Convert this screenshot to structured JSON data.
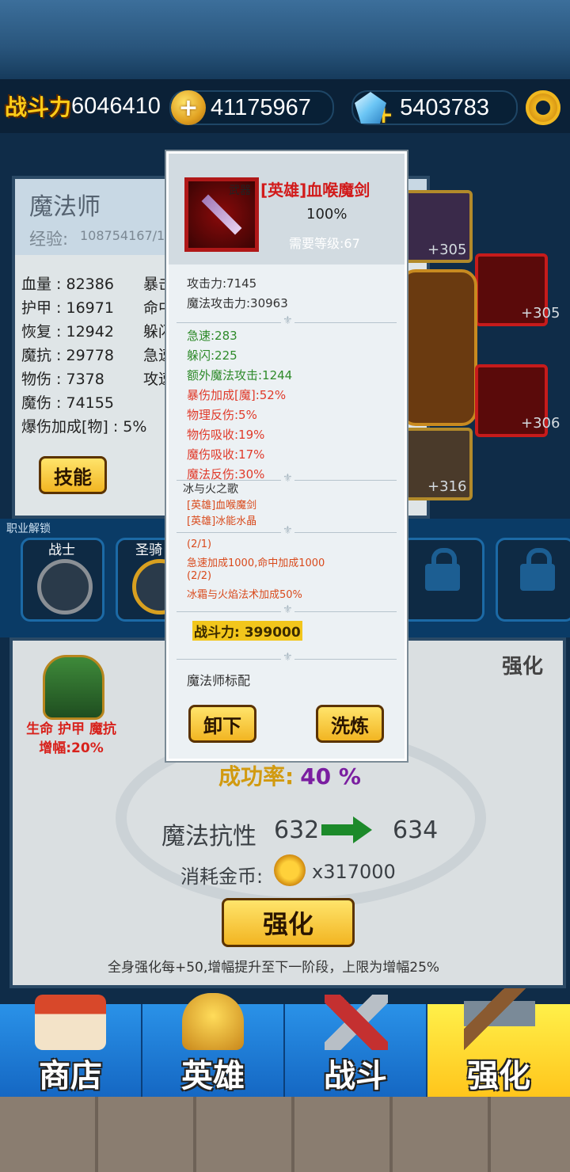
{
  "top": {
    "combat_label": "战斗力",
    "combat_value": "6046410",
    "gold_value": "41175967",
    "gem_value": "5403783",
    "plus": "+"
  },
  "stats_panel": {
    "class_name": "魔法师",
    "exp_label": "经验:",
    "exp_value": "108754167/1",
    "stats": [
      "血量 : 82386",
      "护甲 : 16971",
      "恢复 : 12942",
      "魔抗 : 29778",
      "物伤 : 7378",
      "魔伤 : 74155",
      "爆伤加成[物] : 5%"
    ],
    "stats_right": [
      "暴击",
      "命中",
      "躲闪",
      "急速",
      "攻速"
    ],
    "skill_button": "技能"
  },
  "slots": [
    "+305",
    "+305",
    "+306",
    "+316"
  ],
  "class_row": {
    "title": "职业解锁",
    "classes": [
      "战士",
      "圣骑"
    ]
  },
  "forge": {
    "title": "强化",
    "bonus_text": "生命 护甲 魔抗 增幅:20%",
    "success_label": "成功率:",
    "success_value": "40 %",
    "attr_name": "魔法抗性",
    "attr_from": "632",
    "attr_to": "634",
    "cost_label": "消耗金币:",
    "cost_value": "x317000",
    "enhance_button": "强化",
    "footnote": "全身强化每+50,增幅提升至下一阶段，上限为增幅25%"
  },
  "nav": [
    "商店",
    "英雄",
    "战斗",
    "强化"
  ],
  "popup": {
    "type_label": "武器",
    "item_name": "[英雄]血喉魔剑",
    "percent": "100%",
    "level_req": "需要等级:67",
    "base_stats": [
      "攻击力:7145",
      "魔法攻击力:30963"
    ],
    "green_stats": [
      "急速:283",
      "躲闪:225",
      "额外魔法攻击:1244"
    ],
    "red_stats": [
      "暴伤加成[魔]:52%",
      "物理反伤:5%",
      "物伤吸收:19%",
      "魔伤吸收:17%",
      "魔法反伤:30%"
    ],
    "set_name": "冰与火之歌",
    "set_items": [
      "[英雄]血喉魔剑",
      "[英雄]冰能水晶"
    ],
    "set_bonus": [
      "(2/1)",
      "急速加成1000,命中加成1000",
      "(2/2)",
      "冰霜与火焰法术加成50%"
    ],
    "power": "战斗力: 399000",
    "desc": "魔法师标配",
    "btn_unequip": "卸下",
    "btn_refine": "洗炼"
  },
  "colors": {
    "gold_button": "#f2b522",
    "nav_blue": "#1466c2",
    "nav_active": "#ffd21e",
    "stat_red": "#e03a2a",
    "stat_green": "#2e8a2a",
    "success_purple": "#7a1ea0"
  }
}
